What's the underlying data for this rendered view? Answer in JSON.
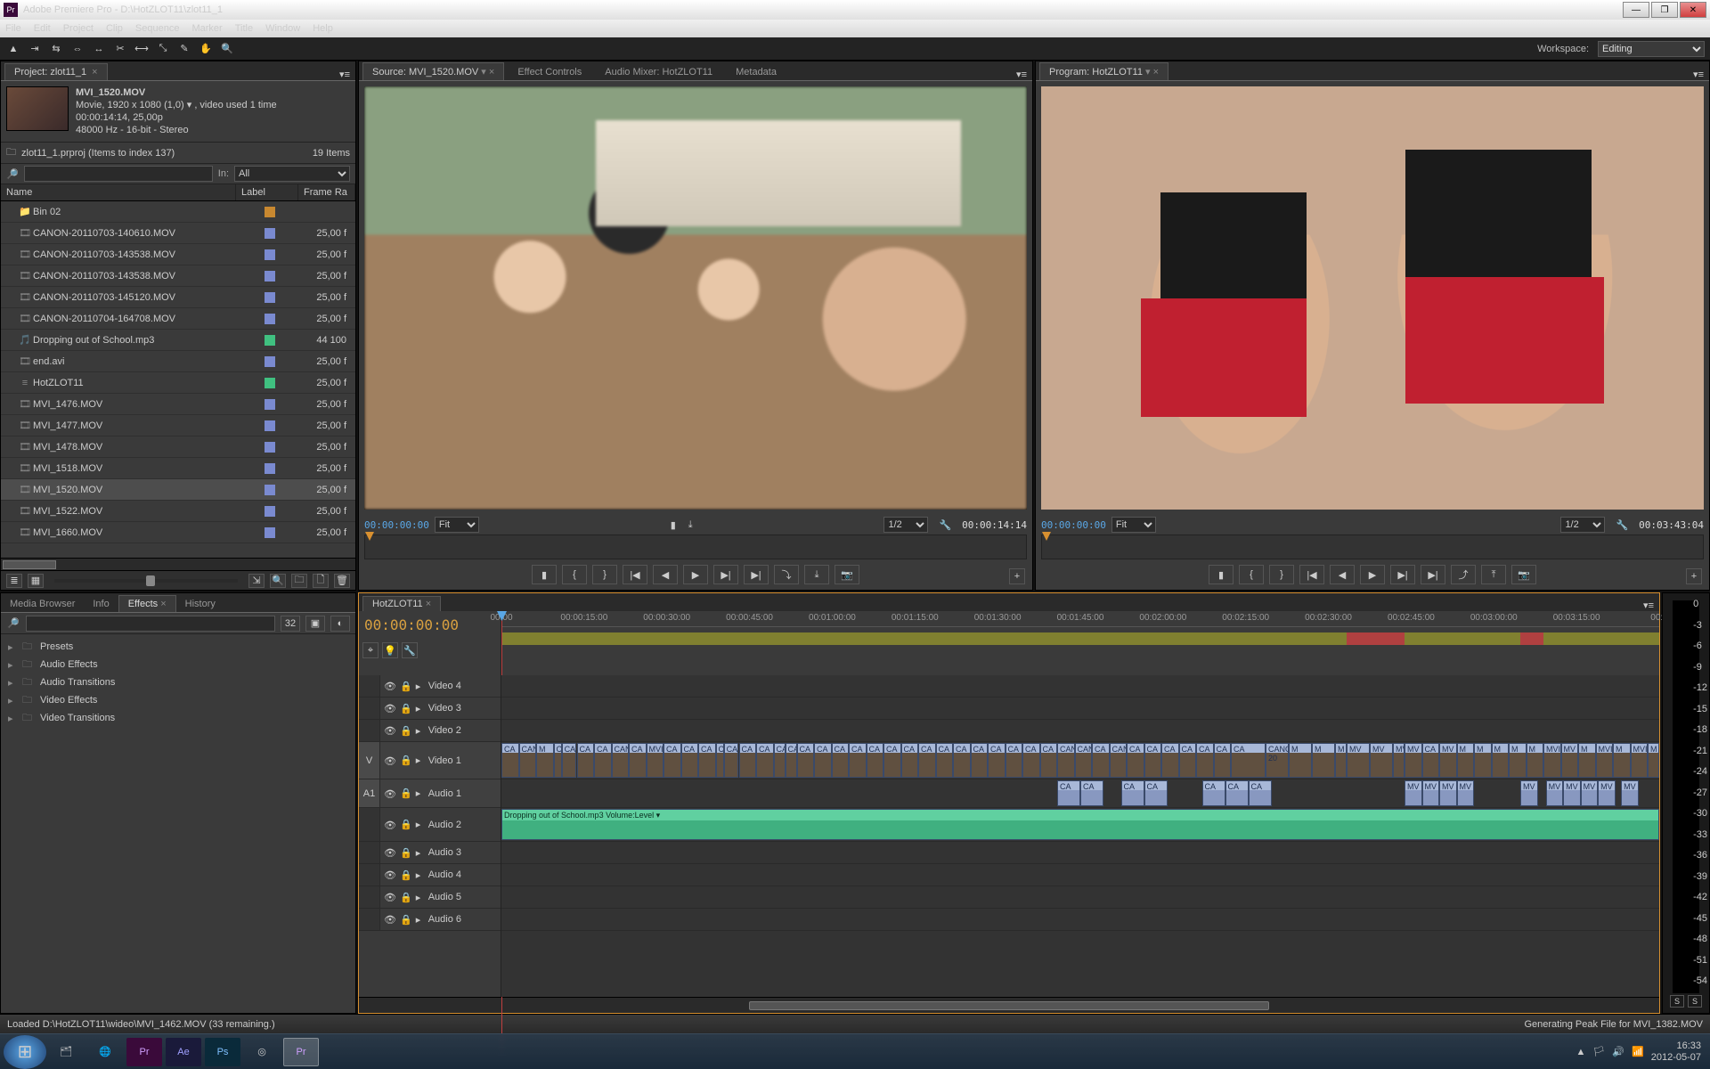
{
  "title": "Adobe Premiere Pro - D:\\HotZLOT11\\zlot11_1",
  "menus": [
    "File",
    "Edit",
    "Project",
    "Clip",
    "Sequence",
    "Marker",
    "Title",
    "Window",
    "Help"
  ],
  "workspace": {
    "label": "Workspace:",
    "value": "Editing"
  },
  "project": {
    "tab": "Project: zlot11_1",
    "clipName": "MVI_1520.MOV",
    "meta1": "Movie, 1920 x 1080 (1,0) ▾ , video used 1 time",
    "meta2": "00:00:14:14, 25,00p",
    "meta3": "48000 Hz - 16-bit - Stereo",
    "binLine": "zlot11_1.prproj (Items to index 137)",
    "itemCount": "19 Items",
    "inLabel": "In:",
    "inValue": "All",
    "cols": {
      "name": "Name",
      "label": "Label",
      "rate": "Frame Ra"
    },
    "items": [
      {
        "icon": "📁",
        "name": "Bin 02",
        "color": "#c88830",
        "rate": "",
        "indent": 0
      },
      {
        "icon": "🎞",
        "name": "CANON-20110703-140610.MOV",
        "color": "#7a8ad0",
        "rate": "25,00 f"
      },
      {
        "icon": "🎞",
        "name": "CANON-20110703-143538.MOV",
        "color": "#7a8ad0",
        "rate": "25,00 f"
      },
      {
        "icon": "🎞",
        "name": "CANON-20110703-143538.MOV",
        "color": "#7a8ad0",
        "rate": "25,00 f"
      },
      {
        "icon": "🎞",
        "name": "CANON-20110703-145120.MOV",
        "color": "#7a8ad0",
        "rate": "25,00 f"
      },
      {
        "icon": "🎞",
        "name": "CANON-20110704-164708.MOV",
        "color": "#7a8ad0",
        "rate": "25,00 f"
      },
      {
        "icon": "🎵",
        "name": "Dropping out of School.mp3",
        "color": "#40c080",
        "rate": "44 100"
      },
      {
        "icon": "🎞",
        "name": "end.avi",
        "color": "#7a8ad0",
        "rate": "25,00 f"
      },
      {
        "icon": "≡",
        "name": "HotZLOT11",
        "color": "#40c080",
        "rate": "25,00 f"
      },
      {
        "icon": "🎞",
        "name": "MVI_1476.MOV",
        "color": "#7a8ad0",
        "rate": "25,00 f"
      },
      {
        "icon": "🎞",
        "name": "MVI_1477.MOV",
        "color": "#7a8ad0",
        "rate": "25,00 f"
      },
      {
        "icon": "🎞",
        "name": "MVI_1478.MOV",
        "color": "#7a8ad0",
        "rate": "25,00 f"
      },
      {
        "icon": "🎞",
        "name": "MVI_1518.MOV",
        "color": "#7a8ad0",
        "rate": "25,00 f"
      },
      {
        "icon": "🎞",
        "name": "MVI_1520.MOV",
        "color": "#7a8ad0",
        "rate": "25,00 f",
        "sel": true
      },
      {
        "icon": "🎞",
        "name": "MVI_1522.MOV",
        "color": "#7a8ad0",
        "rate": "25,00 f"
      },
      {
        "icon": "🎞",
        "name": "MVI_1660.MOV",
        "color": "#7a8ad0",
        "rate": "25,00 f"
      }
    ]
  },
  "source": {
    "tabs": [
      "Source: MVI_1520.MOV",
      "Effect Controls",
      "Audio Mixer: HotZLOT11",
      "Metadata"
    ],
    "ltc": "00:00:00:00",
    "fit": "Fit",
    "scale": "1/2",
    "rtc": "00:00:14:14"
  },
  "program": {
    "tab": "Program: HotZLOT11",
    "ltc": "00:00:00:00",
    "fit": "Fit",
    "scale": "1/2",
    "rtc": "00:03:43:04"
  },
  "effects": {
    "tabs": [
      "Media Browser",
      "Info",
      "Effects",
      "History"
    ],
    "active": 2,
    "folders": [
      "Presets",
      "Audio Effects",
      "Audio Transitions",
      "Video Effects",
      "Video Transitions"
    ]
  },
  "timeline": {
    "tab": "HotZLOT11",
    "tc": "00:00:00:00",
    "ticks": [
      "00:00",
      "00:00:15:00",
      "00:00:30:00",
      "00:00:45:00",
      "00:01:00:00",
      "00:01:15:00",
      "00:01:30:00",
      "00:01:45:00",
      "00:02:00:00",
      "00:02:15:00",
      "00:02:30:00",
      "00:02:45:00",
      "00:03:00:00",
      "00:03:15:00",
      "00:0"
    ],
    "tracks": {
      "v": [
        "Video 4",
        "Video 3",
        "Video 2"
      ],
      "v1": "Video 1",
      "a1": "Audio 1",
      "a2": "Audio 2",
      "a": [
        "Audio 3",
        "Audio 4",
        "Audio 5",
        "Audio 6"
      ]
    },
    "musicClip": "Dropping out of School.mp3   Volume:Level ▾"
  },
  "meterScale": [
    "0",
    "-3",
    "-6",
    "-9",
    "-12",
    "-15",
    "-18",
    "-21",
    "-24",
    "-27",
    "-30",
    "-33",
    "-36",
    "-39",
    "-42",
    "-45",
    "-48",
    "-51",
    "-54"
  ],
  "status": {
    "left": "Loaded D:\\HotZLOT11\\wideo\\MVI_1462.MOV (33 remaining.)",
    "right": "Generating Peak File for MVI_1382.MOV"
  },
  "tray": {
    "time": "16:33",
    "date": "2012-05-07"
  }
}
